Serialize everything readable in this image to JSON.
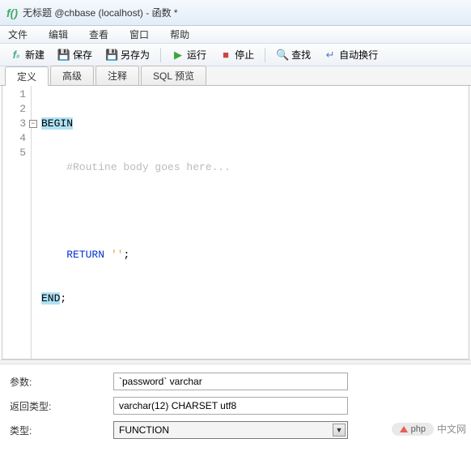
{
  "titlebar": {
    "icon_label": "f()",
    "title": "无标题 @chbase (localhost) - 函数 *"
  },
  "menubar": {
    "items": [
      "文件",
      "编辑",
      "查看",
      "窗口",
      "帮助"
    ]
  },
  "toolbar": {
    "new": "新建",
    "save": "保存",
    "saveas": "另存为",
    "run": "运行",
    "stop": "停止",
    "find": "查找",
    "wrap": "自动换行"
  },
  "tabs": {
    "items": [
      "定义",
      "高级",
      "注释",
      "SQL 预览"
    ],
    "active_index": 0
  },
  "editor": {
    "line_numbers": [
      "1",
      "2",
      "3",
      "4",
      "5"
    ],
    "lines": {
      "l1_begin": "BEGIN",
      "l2_comment": "    #Routine body goes here...",
      "l3_blank": " ",
      "l4_return_kw": "    RETURN ",
      "l4_string": "''",
      "l4_semi": ";",
      "l5_end": "END",
      "l5_semi": ";"
    }
  },
  "form": {
    "params_label": "参数:",
    "params_value": "`password` varchar",
    "return_type_label": "返回类型:",
    "return_type_value": "varchar(12) CHARSET utf8",
    "type_label": "类型:",
    "type_value": "FUNCTION"
  },
  "watermark": {
    "badge": "php",
    "text": "中文网"
  }
}
